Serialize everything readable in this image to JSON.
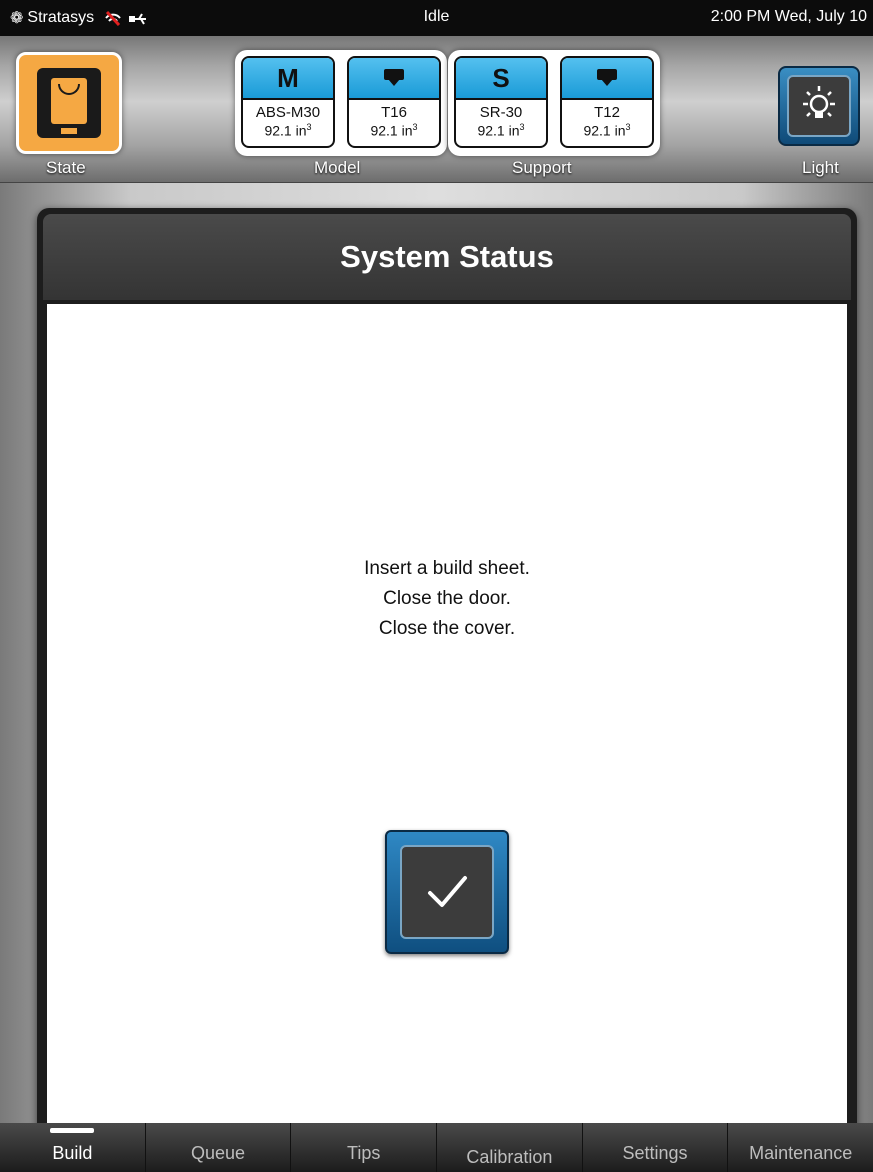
{
  "status_bar": {
    "brand": "Stratasys",
    "state": "Idle",
    "datetime": "2:00 PM Wed, July 10"
  },
  "toolbar": {
    "state_label": "State",
    "model_label": "Model",
    "support_label": "Support",
    "light_label": "Light",
    "materials": [
      {
        "head": "M",
        "name": "ABS-M30",
        "volume": "92.1 in",
        "unit_exp": "3"
      },
      {
        "head_icon": "tip-icon",
        "name": "T16",
        "volume": "92.1 in",
        "unit_exp": "3"
      },
      {
        "head": "S",
        "name": "SR-30",
        "volume": "92.1 in",
        "unit_exp": "3"
      },
      {
        "head_icon": "tip-icon",
        "name": "T12",
        "volume": "92.1 in",
        "unit_exp": "3"
      }
    ]
  },
  "dialog": {
    "title": "System Status",
    "lines": [
      "Insert a build sheet.",
      "Close the door.",
      "Close the cover."
    ],
    "confirm_icon": "checkmark-icon"
  },
  "tabs": [
    {
      "label": "Build",
      "active": true
    },
    {
      "label": "Queue"
    },
    {
      "label": "Tips"
    },
    {
      "label": "Calibration"
    },
    {
      "label": "Settings"
    },
    {
      "label": "Maintenance"
    }
  ],
  "colors": {
    "state_orange": "#f5a843",
    "material_blue": "#1a9bd7",
    "button_blue": "#1f6fa8"
  }
}
